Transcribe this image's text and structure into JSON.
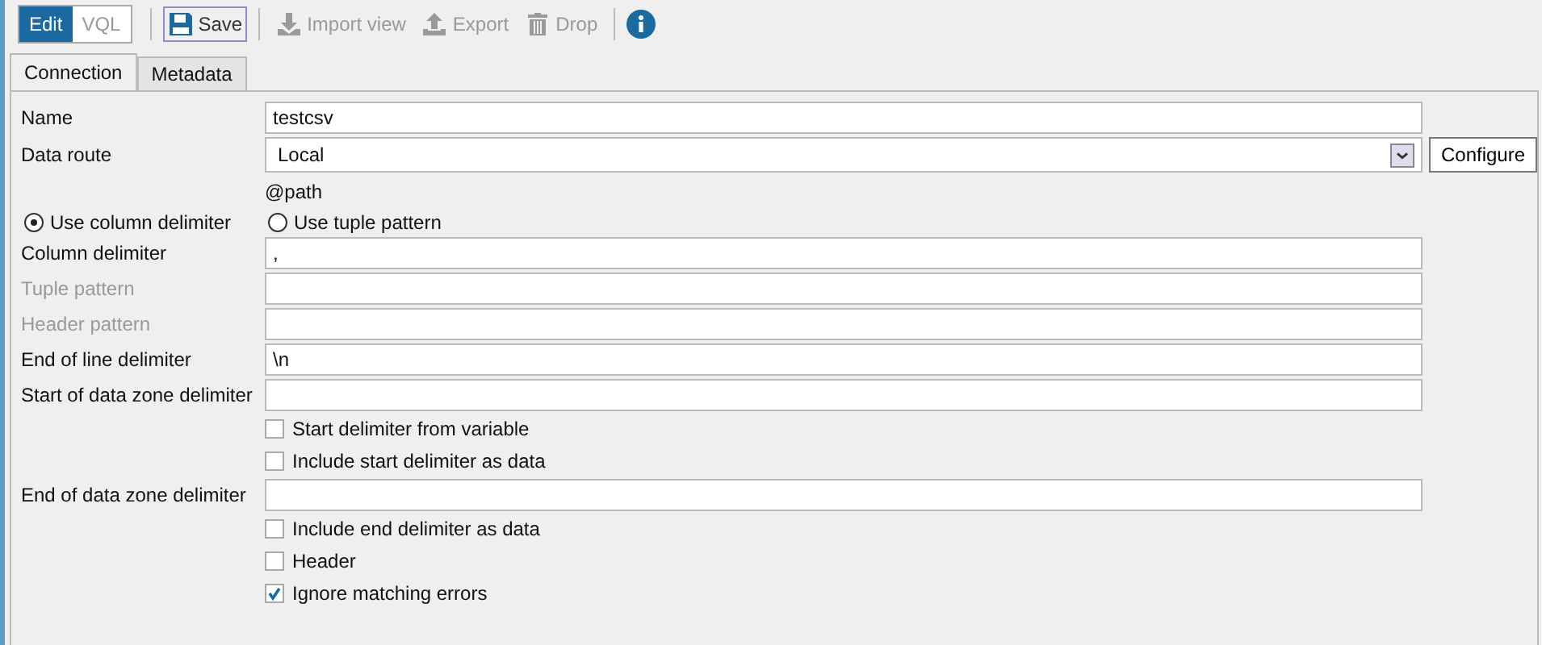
{
  "mode_switch": [
    {
      "label": "Edit",
      "selected": true
    },
    {
      "label": "VQL",
      "selected": false
    }
  ],
  "toolbar": [
    {
      "kind": "save",
      "label": "Save",
      "disabled": false
    },
    {
      "kind": "import",
      "label": "Import view",
      "disabled": true
    },
    {
      "kind": "export",
      "label": "Export",
      "disabled": true
    },
    {
      "kind": "drop",
      "label": "Drop",
      "disabled": true
    },
    {
      "kind": "info"
    }
  ],
  "tabs": [
    {
      "label": "Connection",
      "selected": true
    },
    {
      "label": "Metadata",
      "selected": false
    }
  ],
  "form": [
    {
      "kind": "field",
      "label": "Name",
      "value": "testcsv",
      "disabled": false
    },
    {
      "kind": "select",
      "label": "Data route",
      "value": "Local",
      "button": "Configure"
    },
    {
      "kind": "note",
      "text": "@path"
    },
    {
      "kind": "radios",
      "options": [
        {
          "label": "Use column delimiter",
          "selected": true
        },
        {
          "label": "Use tuple pattern",
          "selected": false
        }
      ]
    },
    {
      "kind": "field",
      "label": "Column delimiter",
      "value": ",",
      "disabled": false
    },
    {
      "kind": "field",
      "label": "Tuple pattern",
      "disabled": true
    },
    {
      "kind": "field",
      "label": "Header pattern",
      "disabled": true
    },
    {
      "kind": "field",
      "label": "End of line delimiter",
      "value": "\\n",
      "disabled": false
    },
    {
      "kind": "field",
      "label": "Start of data zone delimiter",
      "disabled": false
    },
    {
      "kind": "checkbox",
      "label": "Start delimiter from variable",
      "checked": false
    },
    {
      "kind": "checkbox",
      "label": "Include start delimiter as data",
      "checked": false
    },
    {
      "kind": "field",
      "label": "End of data zone delimiter",
      "disabled": false
    },
    {
      "kind": "checkbox",
      "label": "Include end delimiter as data",
      "checked": false
    },
    {
      "kind": "checkbox",
      "label": "Header",
      "checked": false
    },
    {
      "kind": "checkbox",
      "label": "Ignore matching errors",
      "checked": true
    }
  ]
}
